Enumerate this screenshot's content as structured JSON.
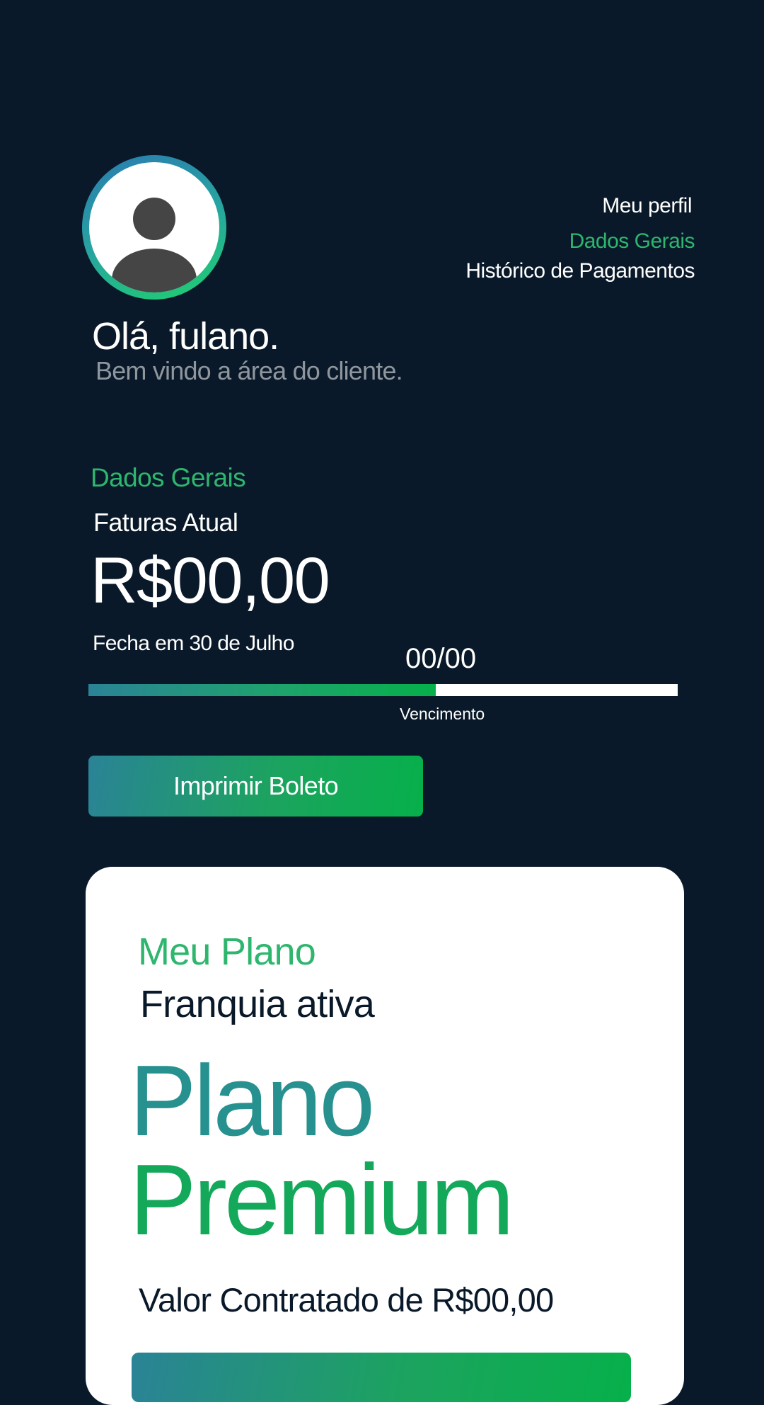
{
  "header": {
    "avatar_icon": "user-avatar-icon",
    "nav": {
      "profile": "Meu perfil",
      "general_data": "Dados Gerais",
      "payment_history": "Histórico de Pagamentos"
    },
    "greeting": "Olá, fulano.",
    "welcome": "Bem vindo a área do cliente."
  },
  "general": {
    "section_title": "Dados Gerais",
    "invoice_label": "Faturas Atual",
    "invoice_amount": "R$00,00",
    "closes_label": "Fecha em 30 de Julho",
    "due_value": "00/00",
    "due_label": "Vencimento",
    "due_progress_percent": 59,
    "print_button": "Imprimir Boleto"
  },
  "plan": {
    "title": "Meu Plano",
    "subtitle": "Franquia ativa",
    "name_line1": "Plano",
    "name_line2": "Premium",
    "contract_value": "Valor Contratado de R$00,00"
  },
  "colors": {
    "background": "#0a1929",
    "accent_green": "#2eb66e",
    "accent_teal": "#27918f",
    "card": "#ffffff"
  }
}
